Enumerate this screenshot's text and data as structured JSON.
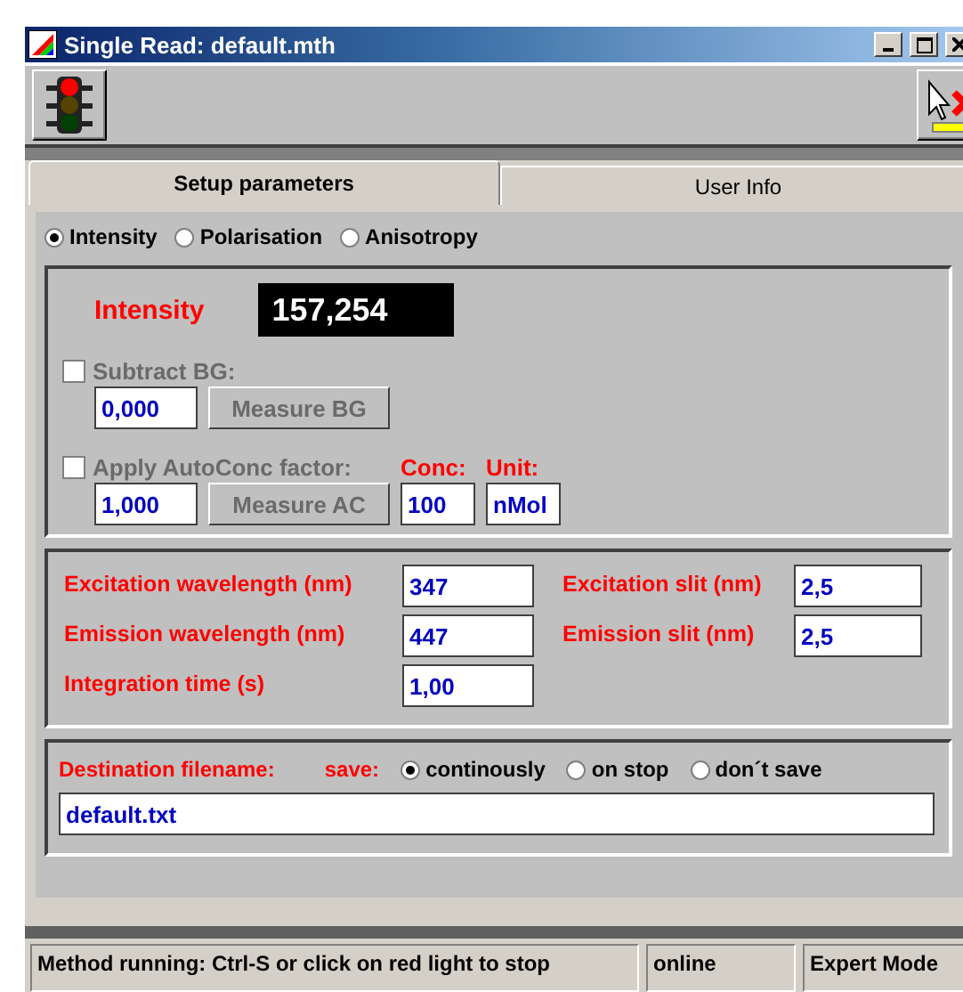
{
  "window": {
    "title": "Single Read: default.mth"
  },
  "tabs": [
    {
      "label": "Setup parameters",
      "selected": true
    },
    {
      "label": "User Info",
      "selected": false
    }
  ],
  "measure_mode": [
    {
      "label": "Intensity",
      "selected": true
    },
    {
      "label": "Polarisation",
      "selected": false
    },
    {
      "label": "Anisotropy",
      "selected": false
    }
  ],
  "reading": {
    "label": "Intensity",
    "value": "157,254"
  },
  "subtract_bg": {
    "label": "Subtract BG:",
    "checked": false,
    "disabled": true,
    "value": "0,000",
    "button": "Measure BG"
  },
  "autoconc": {
    "label": "Apply AutoConc factor:",
    "checked": false,
    "disabled": true,
    "value": "1,000",
    "button": "Measure AC",
    "conc_label": "Conc:",
    "conc": "100",
    "unit_label": "Unit:",
    "unit": "nMol"
  },
  "left_parameters": [
    {
      "label": "Excitation wavelength (nm)",
      "value": "347"
    },
    {
      "label": "Emission wavelength (nm)",
      "value": "447"
    },
    {
      "label": "Integration time (s)",
      "value": "1,00"
    }
  ],
  "right_parameters": [
    {
      "label": "Excitation slit (nm)",
      "value": "2,5"
    },
    {
      "label": "Emission slit (nm)",
      "value": "2,5"
    }
  ],
  "destination": {
    "label": "Destination filename:",
    "save_label": "save:",
    "save_options": [
      {
        "label": "continously",
        "selected": true
      },
      {
        "label": "on stop",
        "selected": false
      },
      {
        "label": "don´t save",
        "selected": false
      }
    ],
    "value": "default.txt"
  },
  "status_bar": [
    "Method running: Ctrl-S or click on red light to stop",
    "online",
    "Expert Mode"
  ]
}
